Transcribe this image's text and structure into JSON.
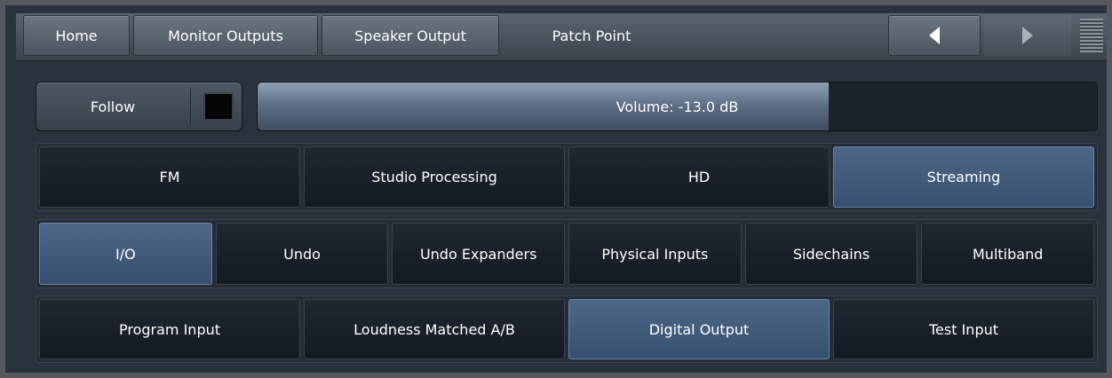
{
  "topbar": {
    "tabs": [
      "Home",
      "Monitor Outputs",
      "Speaker Output",
      "Patch Point"
    ],
    "prev_icon": "triangle-left-icon",
    "next_icon": "triangle-right-icon",
    "menu_icon": "menu-lines-icon"
  },
  "follow": {
    "label": "Follow",
    "checked": false
  },
  "volume": {
    "label": "Volume: -13.0 dB",
    "fill_fraction": 0.68
  },
  "row1": {
    "items": [
      "FM",
      "Studio Processing",
      "HD",
      "Streaming"
    ],
    "active_index": 3
  },
  "row2": {
    "items": [
      "I/O",
      "Undo",
      "Undo Expanders",
      "Physical Inputs",
      "Sidechains",
      "Multiband"
    ],
    "active_index": 0
  },
  "row3": {
    "items": [
      "Program Input",
      "Loudness Matched A/B",
      "Digital Output",
      "Test Input"
    ],
    "active_index": 2
  },
  "colors": {
    "active_button": "#3f5878",
    "inactive_button": "#18202a",
    "volume_fill": "#6b7b90",
    "frame": "#55585c"
  }
}
